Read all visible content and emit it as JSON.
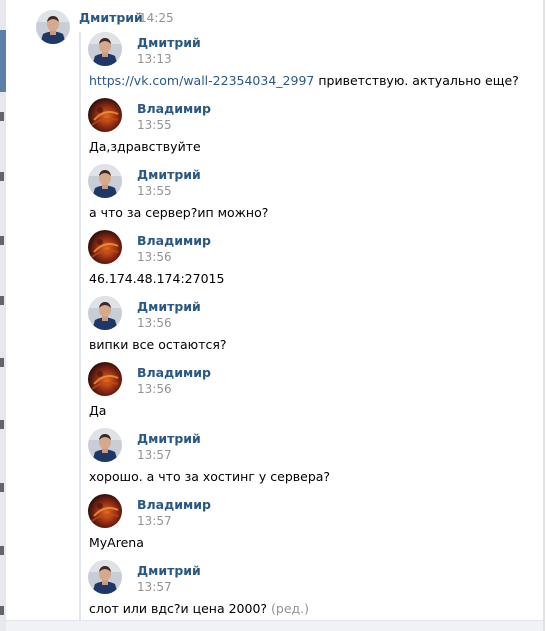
{
  "head": {
    "author": "Дмитрий",
    "time": "14:25"
  },
  "messages": [
    {
      "author": "Дмитрий",
      "time": "13:13",
      "link": "https://vk.com/wall-22354034_2997",
      "text": "приветствую. актуально еще?",
      "avatar": "dmitriy"
    },
    {
      "author": "Владимир",
      "time": "13:55",
      "text": "Да,здравствуйте",
      "avatar": "vladimir"
    },
    {
      "author": "Дмитрий",
      "time": "13:55",
      "text": "а что за сервер?ип можно?",
      "avatar": "dmitriy"
    },
    {
      "author": "Владимир",
      "time": "13:56",
      "text": "46.174.48.174:27015",
      "avatar": "vladimir"
    },
    {
      "author": "Дмитрий",
      "time": "13:56",
      "text": "випки все остаются?",
      "avatar": "dmitriy"
    },
    {
      "author": "Владимир",
      "time": "13:56",
      "text": "Да",
      "avatar": "vladimir"
    },
    {
      "author": "Дмитрий",
      "time": "13:57",
      "text": "хорошо. а что за хостинг у сервера?",
      "avatar": "dmitriy"
    },
    {
      "author": "Владимир",
      "time": "13:57",
      "text": "MyArena",
      "avatar": "vladimir"
    },
    {
      "author": "Дмитрий",
      "time": "13:57",
      "text": "слот или вдс?и цена 2000?",
      "edited": "(ред.)",
      "avatar": "dmitriy"
    }
  ],
  "colors": {
    "author": "#2a5885",
    "time": "#939393",
    "text": "#000000"
  }
}
